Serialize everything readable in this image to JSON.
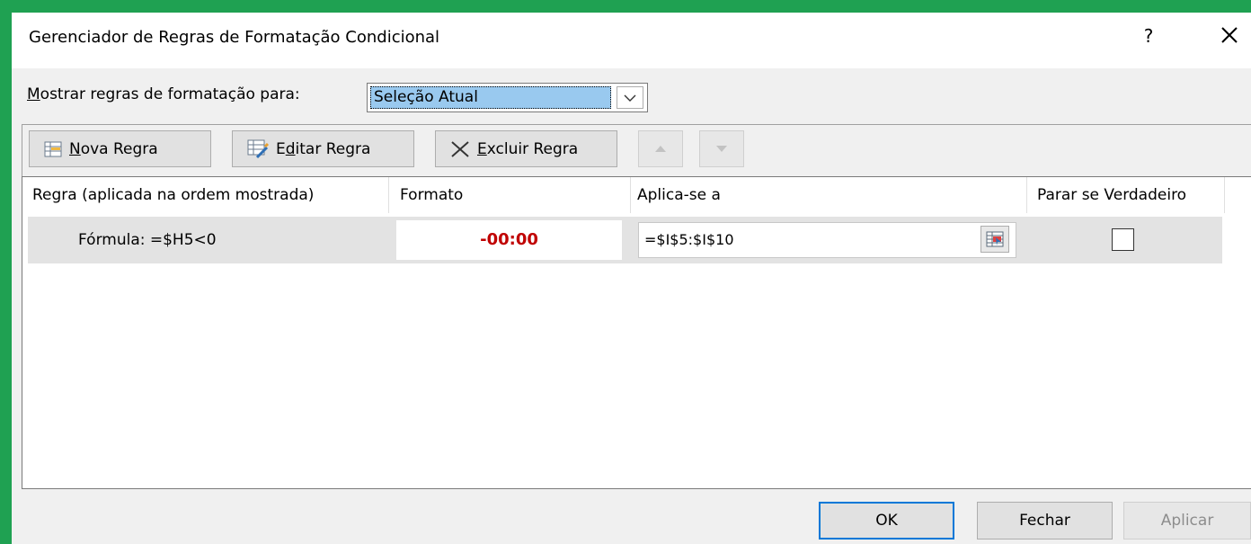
{
  "dialog": {
    "title": "Gerenciador de Regras de Formatação Condicional",
    "help": "?"
  },
  "show_rules": {
    "label_first": "M",
    "label_rest": "ostrar regras de formatação para:",
    "selected": "Seleção Atual"
  },
  "toolbar": {
    "new_rule": {
      "pre": "",
      "ul": "N",
      "post": "ova Regra"
    },
    "edit_rule": {
      "pre": "E",
      "ul": "d",
      "post": "itar Regra"
    },
    "delete_rule": {
      "pre": "",
      "ul": "E",
      "post": "xcluir Regra"
    }
  },
  "table": {
    "headers": {
      "rule": "Regra (aplicada na ordem mostrada)",
      "format": "Formato",
      "applies": "Aplica-se a",
      "stop": "Parar se Verdadeiro"
    },
    "rows": [
      {
        "rule": "Fórmula: =$H5<0",
        "format": "-00:00",
        "applies": "=$I$5:$I$10",
        "stop_if_true": false
      }
    ]
  },
  "buttons": {
    "ok": "OK",
    "close": "Fechar",
    "apply": "Aplicar"
  },
  "colors": {
    "accent": "#0078d7",
    "format_preview": "#c00000",
    "selection": "#99c9ef",
    "background_green": "#1fa152"
  }
}
